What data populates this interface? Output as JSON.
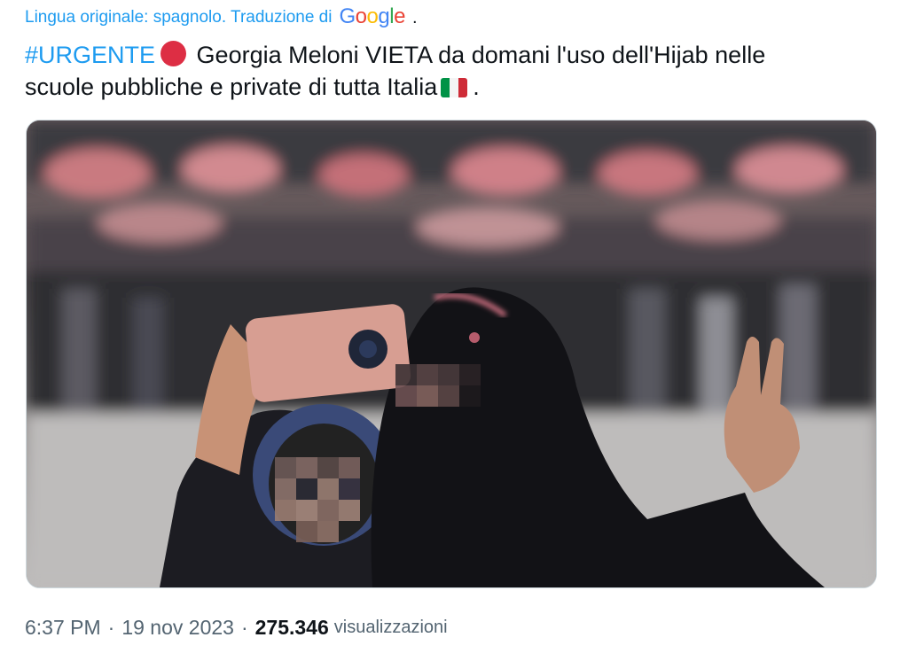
{
  "translation": {
    "label": "Lingua originale: spagnolo. Traduzione di",
    "brand": "Google",
    "trailing": "."
  },
  "tweet": {
    "hashtag": "#URGENTE",
    "emoji_circle": "red-circle",
    "text_line1": "Georgia Meloni VIETA da domani l'uso dell'Hijab nelle",
    "text_line2": "scuole pubbliche e private di tutta Italia",
    "emoji_flag": "italy-flag",
    "trailing": "."
  },
  "media": {
    "description_icon": "photo"
  },
  "meta": {
    "time": "6:37 PM",
    "separator": "·",
    "date": "19 nov 2023",
    "views_count": "275.346",
    "views_label": "visualizzazioni"
  },
  "colors": {
    "link": "#1d9bf0",
    "text": "#0f1419",
    "secondary": "#536471",
    "border": "#cfd9de"
  }
}
